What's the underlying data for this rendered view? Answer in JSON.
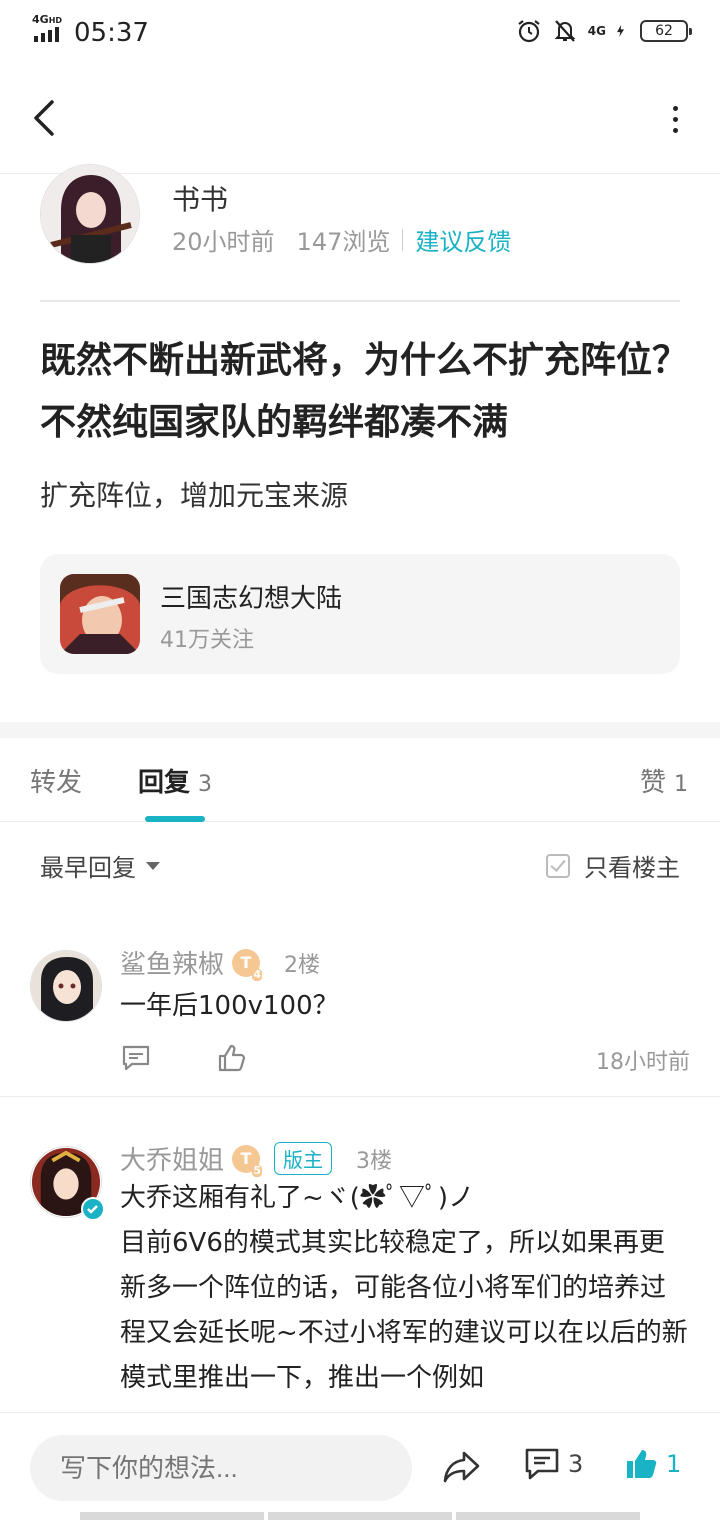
{
  "status_bar": {
    "network": "4G",
    "network_sup": "HD",
    "time": "05:37",
    "mobile_data": "4G",
    "battery": "62"
  },
  "post": {
    "author": "书书",
    "time_ago": "20小时前",
    "views": "147浏览",
    "category_link": "建议反馈",
    "title": "既然不断出新武将，为什么不扩充阵位？不然纯国家队的羁绊都凑不满",
    "body": "扩充阵位，增加元宝来源"
  },
  "game_card": {
    "name": "三国志幻想大陆",
    "followers": "41万关注"
  },
  "tabs": {
    "forward": "转发",
    "reply": "回复",
    "reply_count": "3",
    "like": "赞",
    "like_count": "1"
  },
  "sort": {
    "label": "最早回复",
    "only_host": "只看楼主"
  },
  "comments": [
    {
      "name": "鲨鱼辣椒",
      "level": "T",
      "level_sub": "4",
      "floor": "2楼",
      "text": "一年后100v100？",
      "time": "18小时前"
    },
    {
      "name": "大乔姐姐",
      "level": "T",
      "level_sub": "5",
      "badge": "版主",
      "floor": "3楼",
      "text_line1": "大乔这厢有礼了~ヾ(✿ﾟ▽ﾟ)ノ",
      "text_line2": "目前6V6的模式其实比较稳定了，所以如果再更新多一个阵位的话，可能各位小将军们的培养过程又会延长呢~不过小将军的建议可以在以后的新模式里推出一下，推出一个例如"
    }
  ],
  "bottom_bar": {
    "input_placeholder": "写下你的想法...",
    "comment_count": "3",
    "like_count": "1"
  },
  "colors": {
    "accent": "#1ab3c6",
    "level_badge": "#f5c792"
  }
}
